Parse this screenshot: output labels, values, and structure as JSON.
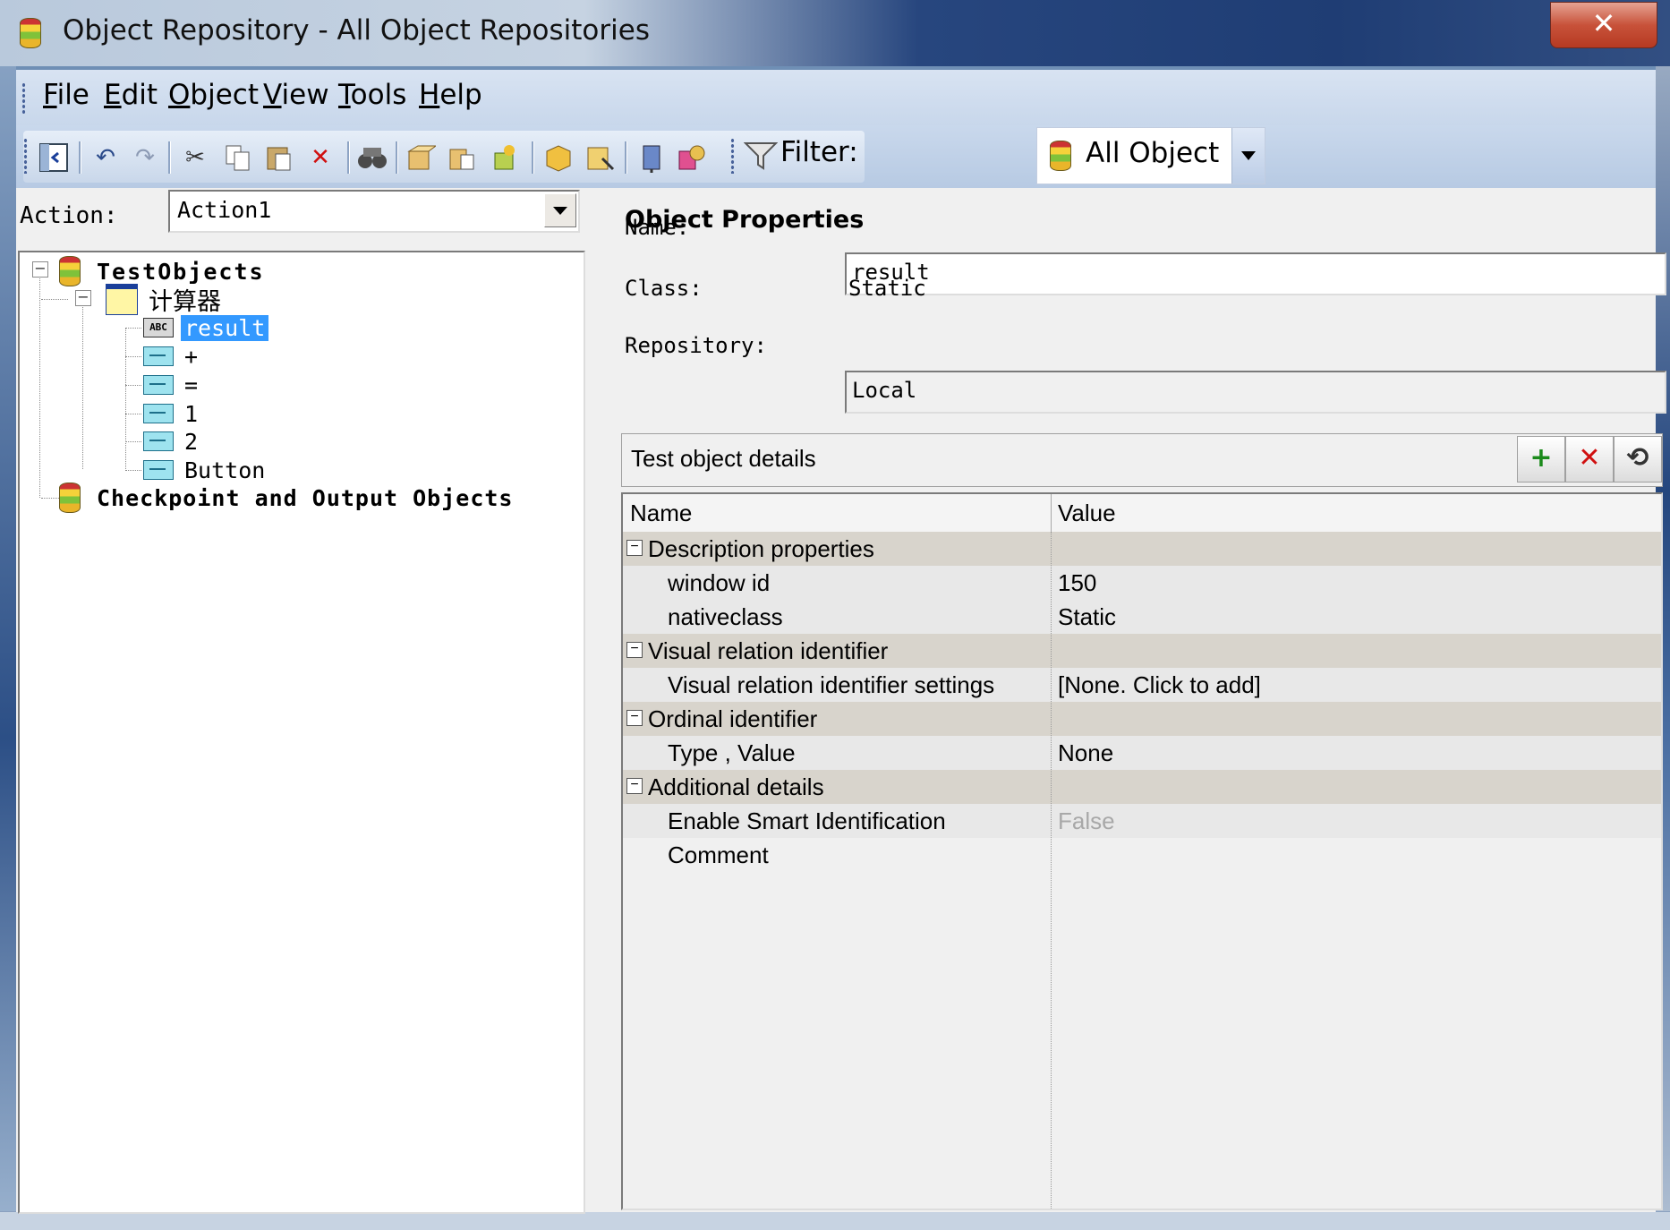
{
  "window": {
    "title": "Object Repository - All Object Repositories",
    "close_label": "✕"
  },
  "menu": [
    {
      "label_u": "F",
      "label_rest": "ile"
    },
    {
      "label_u": "E",
      "label_rest": "dit"
    },
    {
      "label_u": "O",
      "label_rest": "bject"
    },
    {
      "label_u": "V",
      "label_rest": "iew"
    },
    {
      "label_u": "T",
      "label_rest": "ools"
    },
    {
      "label_u": "H",
      "label_rest": "elp"
    }
  ],
  "toolbar": {
    "filter_label": "Filter:",
    "filter_value": "All Object"
  },
  "action": {
    "label": "Action:",
    "value": "Action1"
  },
  "tree": {
    "root": "TestObjects",
    "window_node": "计算器",
    "children": [
      "result",
      "+",
      "=",
      "1",
      "2",
      "Button"
    ],
    "checkpoint_root": "Checkpoint and Output Objects"
  },
  "properties": {
    "heading": "Object Properties",
    "name_label": "Name:",
    "name_value": "result",
    "class_label": "Class:",
    "class_value": "Static",
    "repository_label": "Repository:",
    "repository_value": "Local"
  },
  "details": {
    "header": "Test object details",
    "col_name": "Name",
    "col_value": "Value",
    "rows": [
      {
        "name": "Description properties",
        "value": ""
      },
      {
        "name": "window id",
        "value": "150"
      },
      {
        "name": "nativeclass",
        "value": "Static"
      },
      {
        "name": "Visual relation identifier",
        "value": ""
      },
      {
        "name": "Visual relation identifier settings",
        "value": "[None. Click to add]"
      },
      {
        "name": "Ordinal identifier",
        "value": ""
      },
      {
        "name": "Type , Value",
        "value": "None"
      },
      {
        "name": "Additional details",
        "value": ""
      },
      {
        "name": "Enable Smart Identification",
        "value": "False"
      },
      {
        "name": "Comment",
        "value": ""
      }
    ]
  }
}
